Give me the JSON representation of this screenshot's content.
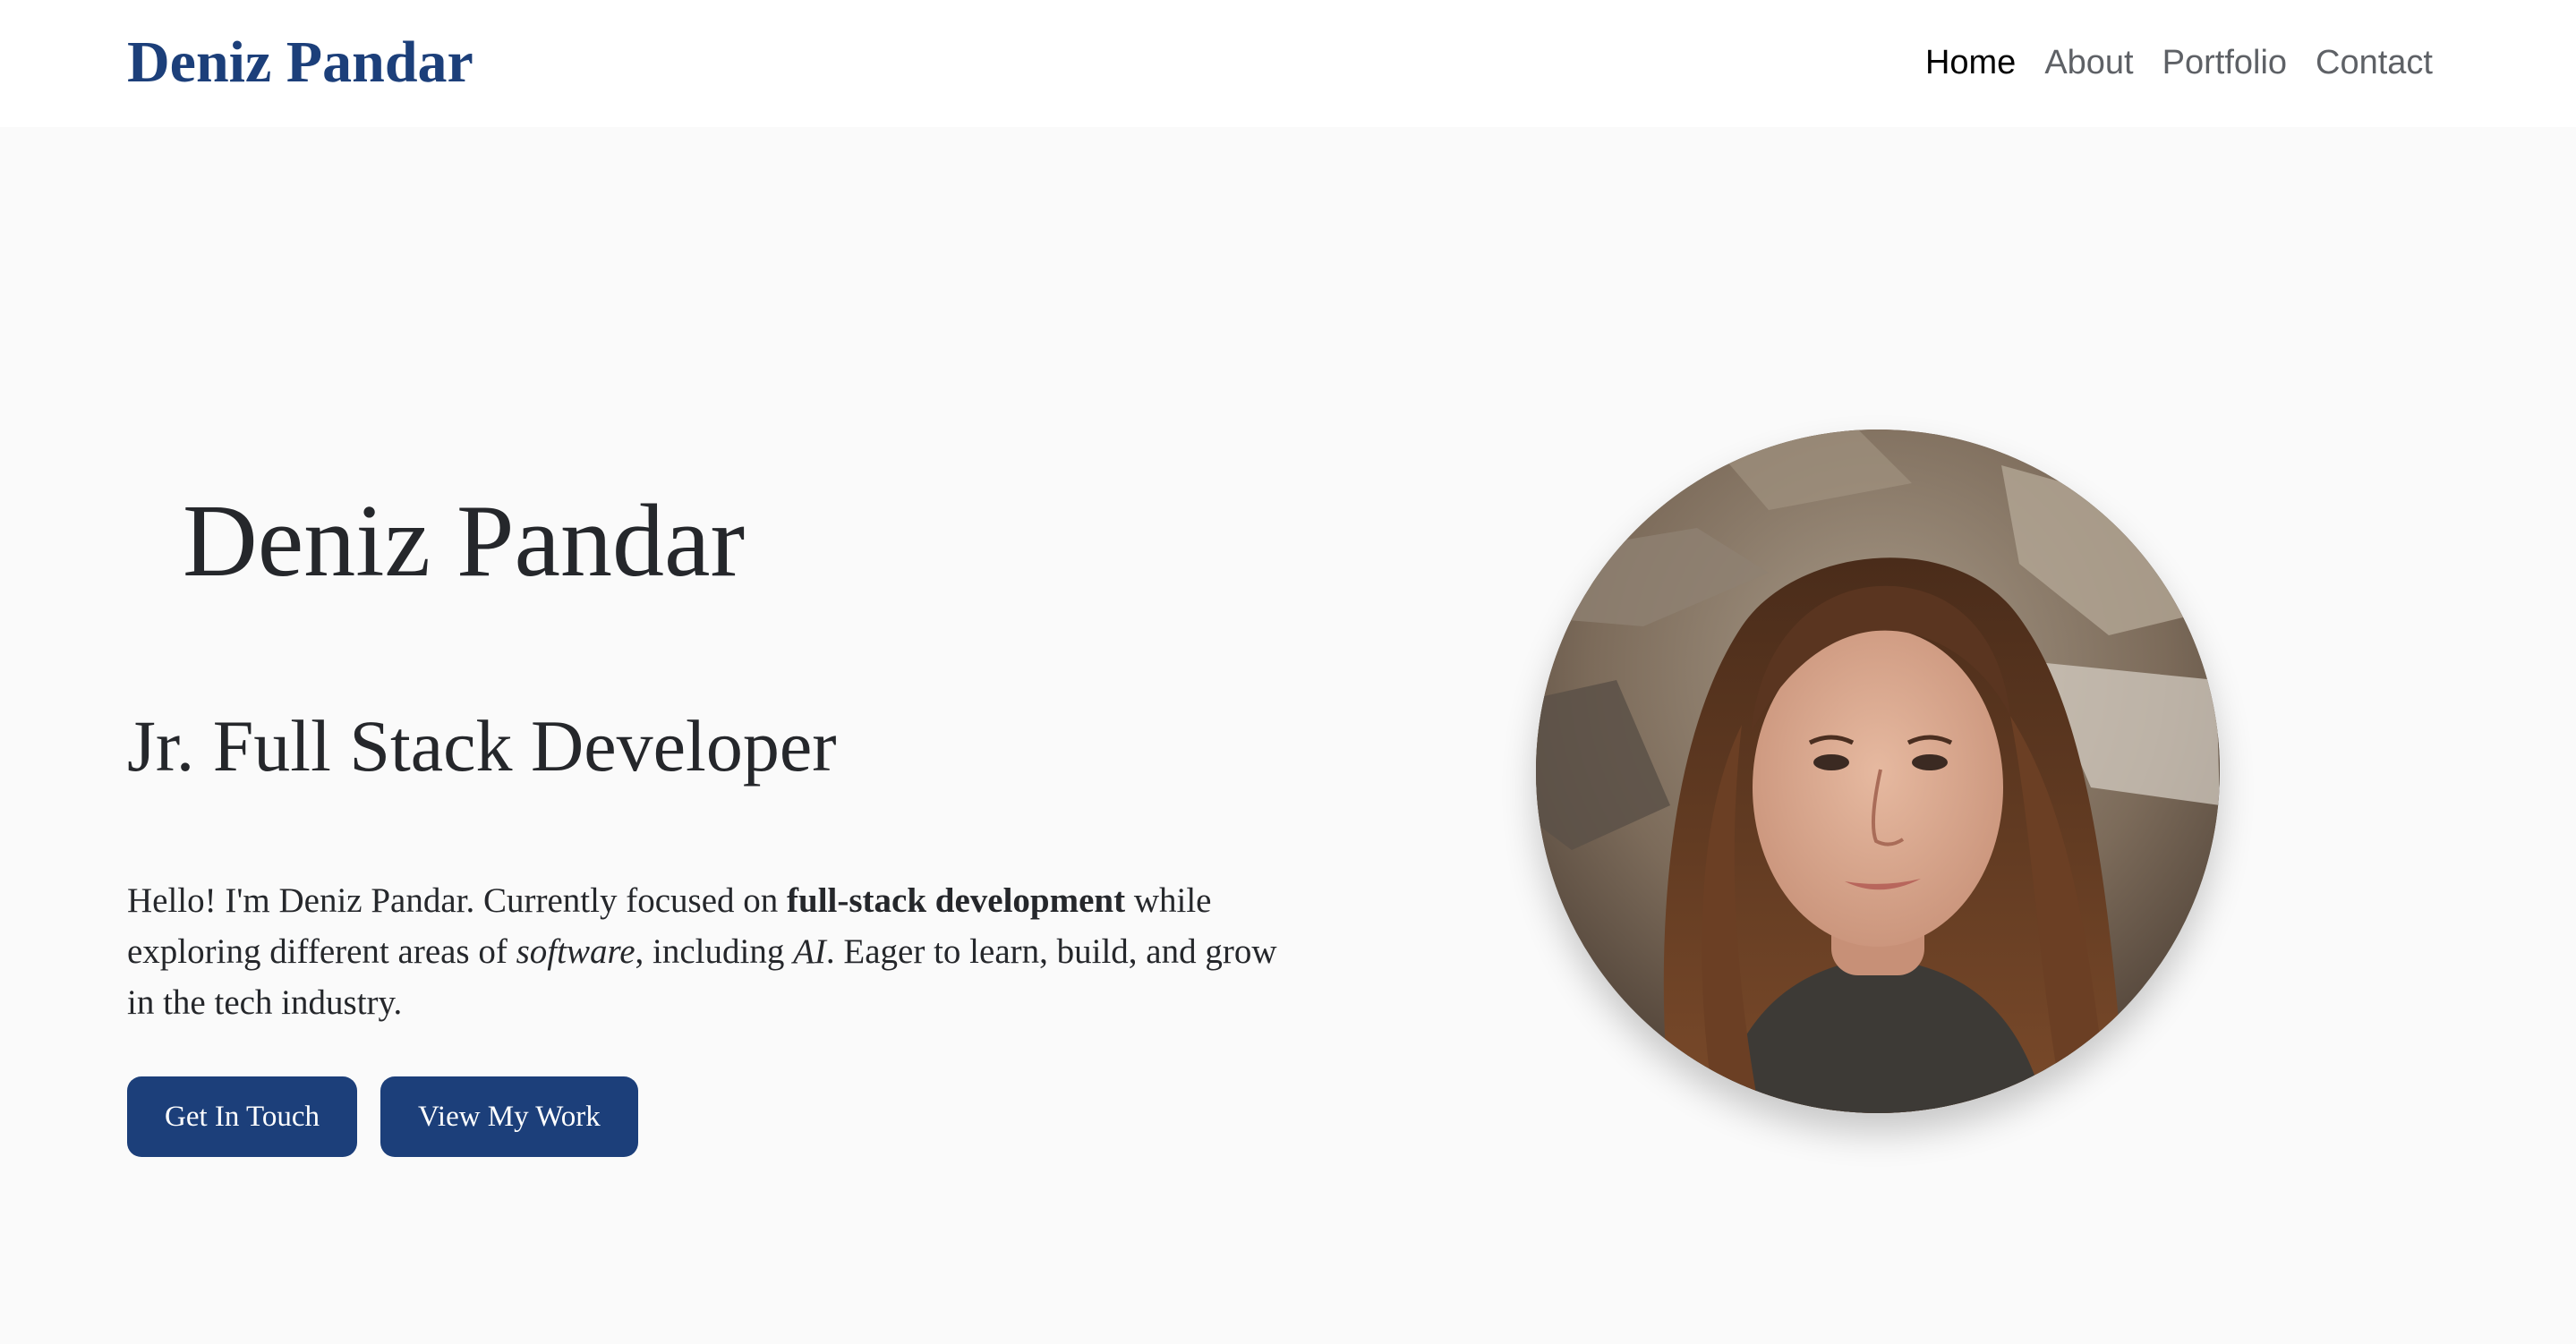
{
  "header": {
    "brand": "Deniz Pandar",
    "nav": [
      {
        "label": "Home",
        "active": true
      },
      {
        "label": "About",
        "active": false
      },
      {
        "label": "Portfolio",
        "active": false
      },
      {
        "label": "Contact",
        "active": false
      }
    ]
  },
  "hero": {
    "name": "Deniz Pandar",
    "role": "Jr. Full Stack Developer",
    "intro": {
      "part1": "Hello! I'm Deniz Pandar. Currently focused on ",
      "bold1": "full-stack development",
      "part2": " while exploring different areas of ",
      "italic1": "software",
      "part3": ", including ",
      "italic2": "AI",
      "part4": ". Eager to learn, build, and grow in the tech industry."
    },
    "buttons": {
      "contact": "Get In Touch",
      "work": "View My Work"
    }
  },
  "colors": {
    "brand": "#1c3f7a",
    "background": "#fafafa",
    "header_bg": "#ffffff",
    "text": "#25272b",
    "nav_inactive": "#5e6166"
  },
  "icons": {
    "portrait": "profile-photo"
  }
}
